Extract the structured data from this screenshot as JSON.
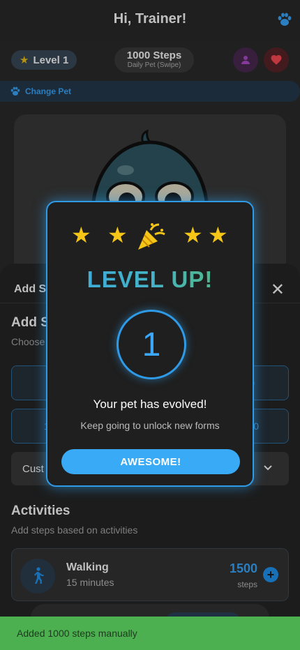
{
  "header": {
    "title": "Hi, Trainer!",
    "paw_icon": "paw-icon"
  },
  "stats": {
    "level_label": "Level 1",
    "steps_main": "1000 Steps",
    "steps_sub": "Daily Pet (Swipe)",
    "profile_icon": "person-icon",
    "heart_icon": "heart-icon"
  },
  "change_pet": {
    "label": "Change Pet"
  },
  "sheet": {
    "title": "Add Steps",
    "close_icon": "close-icon",
    "section_title": "Add Steps",
    "section_sub": "Choose",
    "quick_buttons": [
      "",
      "0",
      "1",
      "0"
    ],
    "custom_label": "Cust",
    "activities_title": "Activities",
    "activities_sub": "Add steps based on activities",
    "activities": [
      {
        "name": "Walking",
        "duration": "15 minutes",
        "steps": "1500",
        "unit": "steps"
      }
    ]
  },
  "dialog": {
    "title": "LEVEL UP!",
    "level": "1",
    "message": "Your pet has evolved!",
    "sub_message": "Keep going to unlock new forms",
    "button_label": "AWESOME!"
  },
  "snackbar": {
    "message": "Added 1000 steps manually"
  },
  "colors": {
    "accent": "#39aaf5",
    "star": "#f5c518",
    "success": "#4caf50",
    "background": "#2b2b2b"
  }
}
